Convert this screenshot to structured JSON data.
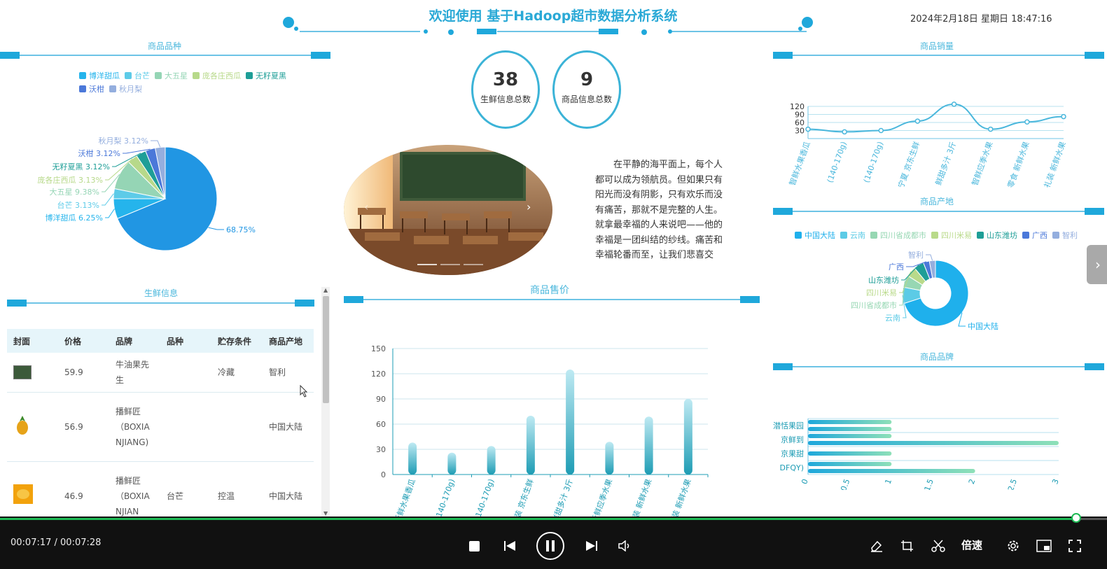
{
  "header": {
    "title": "欢迎使用 基于Hadoop超市数据分析系统",
    "datetime": "2024年2月18日 星期日 18:47:16"
  },
  "sections": {
    "variety": "商品品种",
    "fresh": "生鲜信息",
    "price": "商品售价",
    "sales": "商品销量",
    "origin": "商品产地",
    "brand": "商品品牌"
  },
  "stats": [
    {
      "value": "38",
      "label": "生鲜信息总数"
    },
    {
      "value": "9",
      "label": "商品信息总数"
    }
  ],
  "article": {
    "text": "在平静的海平面上，每个人都可以成为领航员。但如果只有阳光而没有阴影，只有欢乐而没有痛苦，那就不是完整的人生。就拿最幸福的人来说吧——他的幸福是一团纠结的纱线。痛苦和幸福轮番而至，让我们悲喜交加，甚至死亡本身也使生命更加可爱。"
  },
  "carousel": {
    "next": "›",
    "prev": "‹"
  },
  "fresh_table": {
    "headers": [
      "封面",
      "价格",
      "品牌",
      "品种",
      "贮存条件",
      "商品产地"
    ],
    "rows": [
      {
        "price": "59.9",
        "brand": "牛油果先生",
        "variety": "",
        "storage": "冷藏",
        "origin": "智利"
      },
      {
        "price": "56.9",
        "brand": "播鲜匠（BOXIANJIANG)",
        "variety": "",
        "storage": "",
        "origin": "中国大陆"
      },
      {
        "price": "46.9",
        "brand": "播鲜匠（BOXIANJIAN",
        "variety": "台芒",
        "storage": "控温",
        "origin": "中国大陆"
      }
    ]
  },
  "colors": {
    "accent": "#2aa9d6",
    "deco": "#1fa8db",
    "player_bg": "#111111",
    "progress": "#1db954"
  },
  "chart_data": [
    {
      "id": "variety_pie",
      "type": "pie",
      "legend": [
        "博洋甜瓜",
        "台芒",
        "大五星",
        "庞各庄西瓜",
        "无籽夏黑",
        "沃柑",
        "秋月梨"
      ],
      "slices": [
        {
          "name": "",
          "value": 68.75,
          "label": "68.75%",
          "color": "#2196e3"
        },
        {
          "name": "博洋甜瓜",
          "value": 6.25,
          "label": "博洋甜瓜 6.25%",
          "color": "#25b4ec"
        },
        {
          "name": "台芒",
          "value": 3.13,
          "label": "台芒 3.13%",
          "color": "#5dcbe8"
        },
        {
          "name": "大五星",
          "value": 9.38,
          "label": "大五星 9.38%",
          "color": "#95d5b5"
        },
        {
          "name": "庞各庄西瓜",
          "value": 3.13,
          "label": "庞各庄西瓜 3.13%",
          "color": "#b7d98a"
        },
        {
          "name": "无籽夏黑",
          "value": 3.12,
          "label": "无籽夏黑 3.12%",
          "color": "#1e9e97"
        },
        {
          "name": "沃柑",
          "value": 3.12,
          "label": "沃柑 3.12%",
          "color": "#4b78d9"
        },
        {
          "name": "秋月梨",
          "value": 3.12,
          "label": "秋月梨 3.12%",
          "color": "#94aede"
        }
      ]
    },
    {
      "id": "sales_line",
      "type": "line",
      "categories": [
        "智鲜水果香瓜",
        "(140-170g)",
        "(140-170g)",
        "宁夏 京东生鲜",
        "鲜甜多汁 3斤",
        "智鲜应季水果",
        "零食 新鲜水果",
        "礼装 新鲜水果"
      ],
      "values": [
        35,
        25,
        30,
        65,
        128,
        35,
        62,
        82
      ],
      "yticks": [
        30,
        60,
        90,
        120
      ],
      "ylim": [
        0,
        150
      ]
    },
    {
      "id": "price_bar",
      "type": "bar",
      "categories": [
        "新鲜水果香瓜",
        "140-170g)",
        "140-170g)",
        "装 京东生鲜",
        "鲜甜多汁 3斤",
        "新鲜应季水果",
        "盒装 新鲜水果",
        "礼装 新鲜水果"
      ],
      "values": [
        38,
        26,
        34,
        70,
        125,
        39,
        69,
        90
      ],
      "yticks": [
        0,
        30,
        60,
        90,
        120,
        150
      ],
      "ylim": [
        0,
        150
      ]
    },
    {
      "id": "origin_donut",
      "type": "pie",
      "legend": [
        "中国大陆",
        "云南",
        "四川省成都市",
        "四川米易",
        "山东潍坊",
        "广西",
        "智利"
      ],
      "slices": [
        {
          "name": "中国大陆",
          "value": 70,
          "label": "中国大陆",
          "color": "#1fb0ec"
        },
        {
          "name": "云南",
          "value": 8,
          "label": "云南",
          "color": "#5ccbe6"
        },
        {
          "name": "四川省成都市",
          "value": 6,
          "label": "四川省成都市",
          "color": "#97d7b3"
        },
        {
          "name": "四川米易",
          "value": 5,
          "label": "四川米易",
          "color": "#b9da8a"
        },
        {
          "name": "山东潍坊",
          "value": 5,
          "label": "山东潍坊",
          "color": "#1e9e97"
        },
        {
          "name": "广西",
          "value": 3,
          "label": "广西",
          "color": "#4b78d9"
        },
        {
          "name": "智利",
          "value": 3,
          "label": "智利",
          "color": "#94aede"
        }
      ]
    },
    {
      "id": "brand_hbar",
      "type": "bar",
      "orientation": "horizontal",
      "categories": [
        "DFQY)",
        "京果甜",
        "京鲜到",
        "潜恬果园"
      ],
      "label_rows": [
        {
          "label": "DFQY)",
          "bars": [
            1,
            2
          ]
        },
        {
          "label": "京果甜",
          "bars": [
            1
          ]
        },
        {
          "label": "京鲜到",
          "bars": [
            1,
            3
          ]
        },
        {
          "label": "潜恬果园",
          "bars": [
            1,
            1
          ]
        }
      ],
      "xticks": [
        "0",
        "0.5",
        "1",
        "1.5",
        "2",
        "2.5",
        "3"
      ],
      "xlim": [
        0,
        3
      ]
    }
  ],
  "player": {
    "time": "00:07:17 / 00:07:28",
    "progress": 0.977,
    "speed_label": "倍速"
  }
}
